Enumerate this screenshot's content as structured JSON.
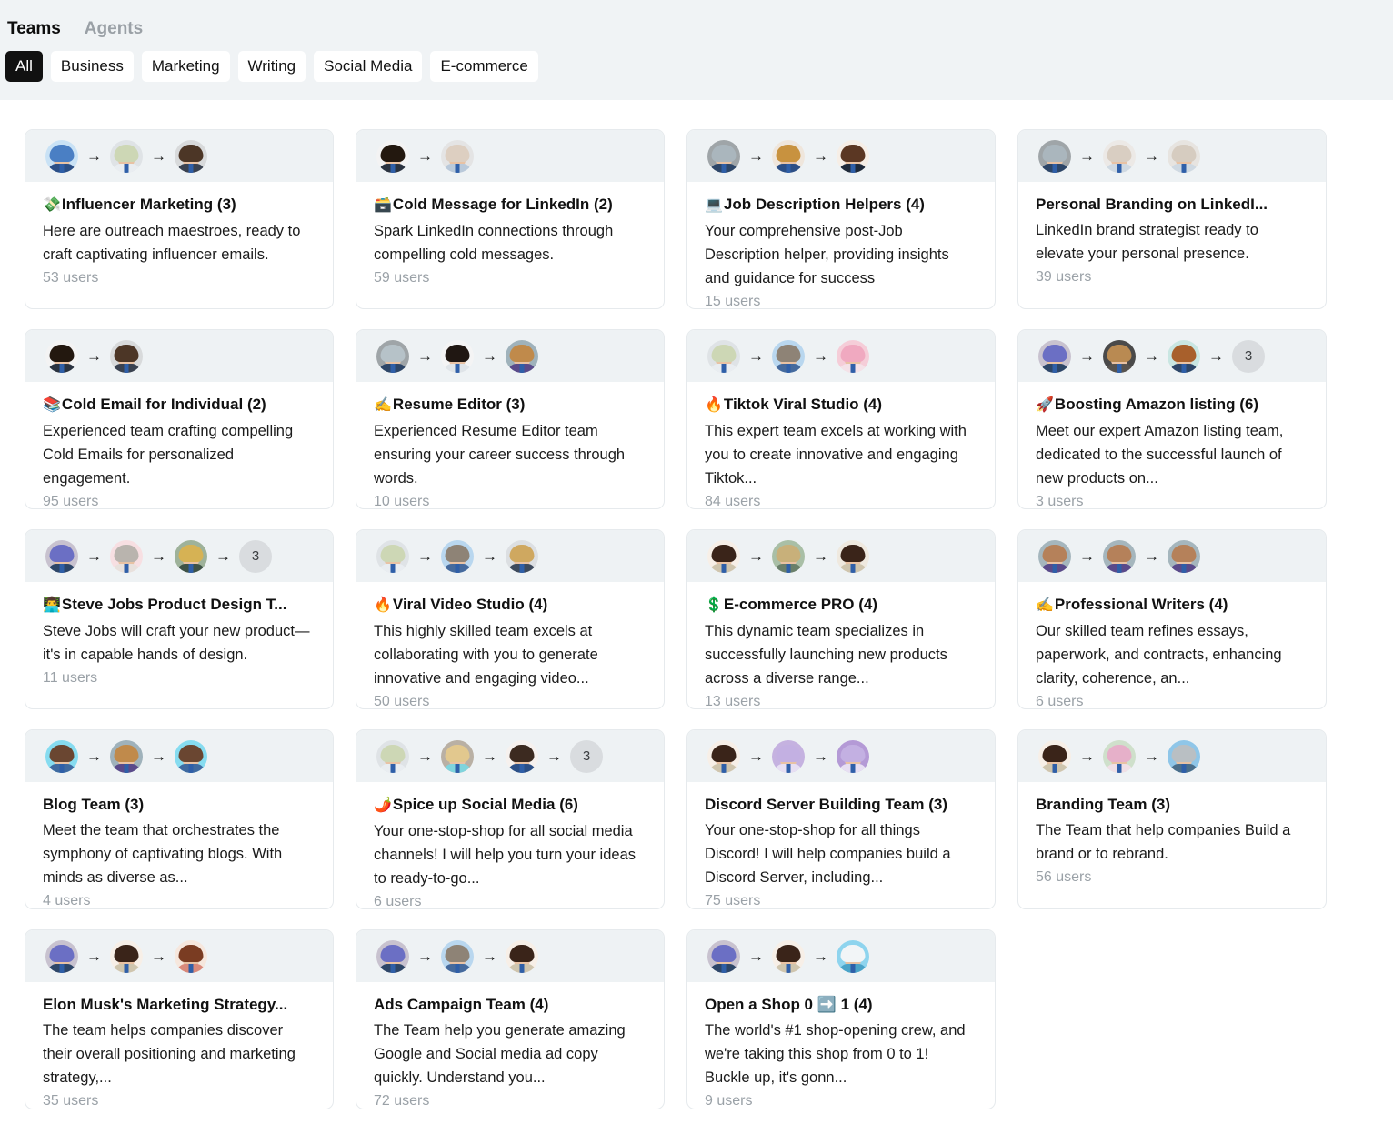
{
  "header": {
    "tabs": [
      {
        "label": "Teams",
        "active": true
      },
      {
        "label": "Agents",
        "active": false
      }
    ],
    "filters": [
      {
        "label": "All",
        "active": true
      },
      {
        "label": "Business",
        "active": false
      },
      {
        "label": "Marketing",
        "active": false
      },
      {
        "label": "Writing",
        "active": false
      },
      {
        "label": "Social Media",
        "active": false
      },
      {
        "label": "E-commerce",
        "active": false
      }
    ]
  },
  "colors": {
    "page_background": "#ffffff",
    "topbar_background": "#f0f3f5",
    "card_header_background": "#eef2f4",
    "card_border": "#e6eaed",
    "chip_active_background": "#111111",
    "muted_text": "#9aa1a7"
  },
  "cards": [
    {
      "emoji": "💸",
      "title": "Influencer Marketing (3)",
      "description": "Here are outreach maestroes, ready to craft captivating influencer emails.",
      "users": "53 users",
      "avatars": [
        {
          "bg": "#c9e2f5",
          "hair": "#4a7fc4",
          "body": "#2b4f86"
        },
        {
          "bg": "#dfe3e6",
          "hair": "#cdd7b5",
          "body": "#e9edf1"
        },
        {
          "bg": "#d8dadb",
          "hair": "#4c3626",
          "body": "#3a4250"
        }
      ],
      "overflow": null
    },
    {
      "emoji": "🗃️",
      "title": "Cold Message for LinkedIn (2)",
      "description": "Spark LinkedIn connections through compelling cold messages.",
      "users": "59 users",
      "avatars": [
        {
          "bg": "#f3f3f3",
          "hair": "#23180f",
          "body": "#2a3340"
        },
        {
          "bg": "#e4e4e4",
          "hair": "#ddcfc1",
          "body": "#b9c9da"
        }
      ],
      "overflow": null
    },
    {
      "emoji": "💻",
      "title": "Job Description Helpers (4)",
      "description": "Your comprehensive post-Job Description helper, providing insights and guidance for success",
      "users": "15 users",
      "avatars": [
        {
          "bg": "#9fa5a8",
          "hair": "#aab6bd",
          "body": "#2d4668"
        },
        {
          "bg": "#efe6dc",
          "hair": "#c8923f",
          "body": "#2c4f86"
        },
        {
          "bg": "#f6eee6",
          "hair": "#5b3723",
          "body": "#1f2a3a"
        }
      ],
      "overflow": null
    },
    {
      "emoji": "",
      "title": "Personal Branding on LinkedI...",
      "description": "LinkedIn brand strategist ready to elevate your personal presence.",
      "users": "39 users",
      "avatars": [
        {
          "bg": "#9fa5a8",
          "hair": "#aab6bd",
          "body": "#2d4668"
        },
        {
          "bg": "#ece9e6",
          "hair": "#d9cec2",
          "body": "#cfd9e2"
        },
        {
          "bg": "#e7e4e0",
          "hair": "#d6ccc0",
          "body": "#cfd9e2"
        }
      ],
      "overflow": null
    },
    {
      "emoji": "📚",
      "title": "Cold Email for Individual (2)",
      "description": "Experienced team crafting compelling Cold Emails for personalized engagement.",
      "users": "95 users",
      "avatars": [
        {
          "bg": "#f3f3f3",
          "hair": "#23180f",
          "body": "#2a3340"
        },
        {
          "bg": "#d8dadb",
          "hair": "#4c3626",
          "body": "#3a4250"
        }
      ],
      "overflow": null
    },
    {
      "emoji": "✍️",
      "title": "Resume Editor (3)",
      "description": "Experienced Resume Editor team ensuring your career success through words.",
      "users": "10 users",
      "avatars": [
        {
          "bg": "#9fa5a8",
          "hair": "#b6c2c8",
          "body": "#2d4668"
        },
        {
          "bg": "#f4f4f4",
          "hair": "#201712",
          "body": "#dfe4e8"
        },
        {
          "bg": "#9fb2bb",
          "hair": "#c08a4b",
          "body": "#5a4a8a"
        }
      ],
      "overflow": null
    },
    {
      "emoji": "🔥",
      "title": "Tiktok Viral Studio (4)",
      "description": "This expert team excels at working with you to create innovative and engaging Tiktok...",
      "users": "84 users",
      "avatars": [
        {
          "bg": "#dfe3e6",
          "hair": "#cdd7b5",
          "body": "#e9edf1"
        },
        {
          "bg": "#b9d7ef",
          "hair": "#8e8376",
          "body": "#456a9d"
        },
        {
          "bg": "#f5cdd8",
          "hair": "#f0a9c0",
          "body": "#f4e2e8"
        }
      ],
      "overflow": null
    },
    {
      "emoji": "🚀",
      "title": "Boosting Amazon listing (6)",
      "description": "Meet our expert Amazon listing team, dedicated to the successful launch of new products on...",
      "users": "3 users",
      "avatars": [
        {
          "bg": "#c8c2cf",
          "hair": "#6b6fc4",
          "body": "#2d4668"
        },
        {
          "bg": "#4a4a4a",
          "hair": "#b98a52",
          "body": "#57534f"
        },
        {
          "bg": "#c9e6e2",
          "hair": "#a8602c",
          "body": "#2d4668"
        }
      ],
      "overflow": "3"
    },
    {
      "emoji": "👨‍💻",
      "title": "Steve Jobs Product Design T...",
      "description": "Steve Jobs will craft your new product—it's in capable hands of design.",
      "users": "11 users",
      "avatars": [
        {
          "bg": "#c8c2cf",
          "hair": "#6b6fc4",
          "body": "#2d4668"
        },
        {
          "bg": "#f7dfe2",
          "hair": "#b9b4ae",
          "body": "#e8e1dd"
        },
        {
          "bg": "#9eb29a",
          "hair": "#d6b254",
          "body": "#3e5246"
        }
      ],
      "overflow": "3"
    },
    {
      "emoji": "🔥",
      "title": "Viral Video Studio (4)",
      "description": "This highly skilled team excels at collaborating with you to generate innovative and engaging video...",
      "users": "50 users",
      "avatars": [
        {
          "bg": "#dfe3e6",
          "hair": "#cdd7b5",
          "body": "#e9edf1"
        },
        {
          "bg": "#b9d7ef",
          "hair": "#8e8376",
          "body": "#456a9d"
        },
        {
          "bg": "#dcdfe2",
          "hair": "#cfa860",
          "body": "#3d4a5c"
        }
      ],
      "overflow": null
    },
    {
      "emoji": "💲",
      "title": "E-commerce PRO (4)",
      "description": "This dynamic team specializes in successfully launching new products across a diverse range...",
      "users": "13 users",
      "avatars": [
        {
          "bg": "#f7efe7",
          "hair": "#3a2419",
          "body": "#cfc5ae"
        },
        {
          "bg": "#a9bfa6",
          "hair": "#c8b07a",
          "body": "#6a7f6a"
        },
        {
          "bg": "#efe9df",
          "hair": "#3a2419",
          "body": "#cfc5ae"
        }
      ],
      "overflow": null
    },
    {
      "emoji": "✍️",
      "title": "Professional Writers (4)",
      "description": "Our skilled team refines essays, paperwork, and contracts, enhancing clarity, coherence, an...",
      "users": "6 users",
      "avatars": [
        {
          "bg": "#a5b6bd",
          "hair": "#b5815a",
          "body": "#5a4a8a"
        },
        {
          "bg": "#a5b6bd",
          "hair": "#b5815a",
          "body": "#5a4a8a"
        },
        {
          "bg": "#a5b6bd",
          "hair": "#b5815a",
          "body": "#5a4a8a"
        }
      ],
      "overflow": null
    },
    {
      "emoji": "",
      "title": "Blog Team (3)",
      "description": "Meet the team that orchestrates the symphony of captivating blogs. With minds as diverse as...",
      "users": "4 users",
      "avatars": [
        {
          "bg": "#86dcf0",
          "hair": "#6a4631",
          "body": "#3f6aa0"
        },
        {
          "bg": "#9fb2bb",
          "hair": "#c08a4b",
          "body": "#5a4a8a"
        },
        {
          "bg": "#86dcf0",
          "hair": "#6a4631",
          "body": "#3f6aa0"
        }
      ],
      "overflow": null
    },
    {
      "emoji": "🌶️",
      "title": "Spice up Social Media (6)",
      "description": "Your one-stop-shop for all social media channels! I will help you turn your ideas to ready-to-go...",
      "users": "6 users",
      "avatars": [
        {
          "bg": "#dfe3e6",
          "hair": "#cdd7b5",
          "body": "#e9edf1"
        },
        {
          "bg": "#b9b0a4",
          "hair": "#e2c88e",
          "body": "#7fd4dd"
        },
        {
          "bg": "#f6f1ee",
          "hair": "#3c2a20",
          "body": "#2b4f86"
        }
      ],
      "overflow": "3"
    },
    {
      "emoji": "",
      "title": "Discord Server Building Team (3)",
      "description": "Your one-stop-shop for all things Discord! I will help companies build a Discord Server, including...",
      "users": "75 users",
      "avatars": [
        {
          "bg": "#f7efe7",
          "hair": "#3a2419",
          "body": "#cfc5ae"
        },
        {
          "bg": "#c5b2e0",
          "hair": "#c3b0e2",
          "body": "#e7dff3"
        },
        {
          "bg": "#b49ad6",
          "hair": "#c3b0e2",
          "body": "#e7dff3"
        }
      ],
      "overflow": null
    },
    {
      "emoji": "",
      "title": "Branding Team (3)",
      "description": "The Team that help companies Build a brand or to rebrand.",
      "users": "56 users",
      "avatars": [
        {
          "bg": "#f7efe7",
          "hair": "#3a2419",
          "body": "#cfc5ae"
        },
        {
          "bg": "#cfe0cb",
          "hair": "#e6b0c9",
          "body": "#f0dfe6"
        },
        {
          "bg": "#8fc6e8",
          "hair": "#b9bfc3",
          "body": "#4a6e8a"
        }
      ],
      "overflow": null
    },
    {
      "emoji": "",
      "title": "Elon Musk's Marketing Strategy...",
      "description": "The team helps companies discover their overall positioning and marketing strategy,...",
      "users": "35 users",
      "avatars": [
        {
          "bg": "#c8c2cf",
          "hair": "#6b6fc4",
          "body": "#2d4668"
        },
        {
          "bg": "#f7efe7",
          "hair": "#3a2419",
          "body": "#cfc5ae"
        },
        {
          "bg": "#f6e7dd",
          "hair": "#7a3c22",
          "body": "#d9897a"
        }
      ],
      "overflow": null
    },
    {
      "emoji": "",
      "title": "Ads Campaign Team (4)",
      "description": "The Team help you generate amazing Google and Social media ad copy quickly. Understand you...",
      "users": "72 users",
      "avatars": [
        {
          "bg": "#c8c2cf",
          "hair": "#6b6fc4",
          "body": "#2d4668"
        },
        {
          "bg": "#b9d7ef",
          "hair": "#8e8376",
          "body": "#456a9d"
        },
        {
          "bg": "#f7efe7",
          "hair": "#3a2419",
          "body": "#cfc5ae"
        }
      ],
      "overflow": null
    },
    {
      "emoji": "",
      "title": "Open a Shop 0 ➡️ 1 (4)",
      "description": "The world's #1 shop-opening crew, and we're taking this shop from 0 to 1! Buckle up, it's gonn...",
      "users": "9 users",
      "avatars": [
        {
          "bg": "#c8c2cf",
          "hair": "#6b6fc4",
          "body": "#2d4668"
        },
        {
          "bg": "#f7efe7",
          "hair": "#3a2419",
          "body": "#cfc5ae"
        },
        {
          "bg": "#8ed4ee",
          "hair": "#f2f5f7",
          "body": "#4aa3c8"
        }
      ],
      "overflow": null
    }
  ]
}
